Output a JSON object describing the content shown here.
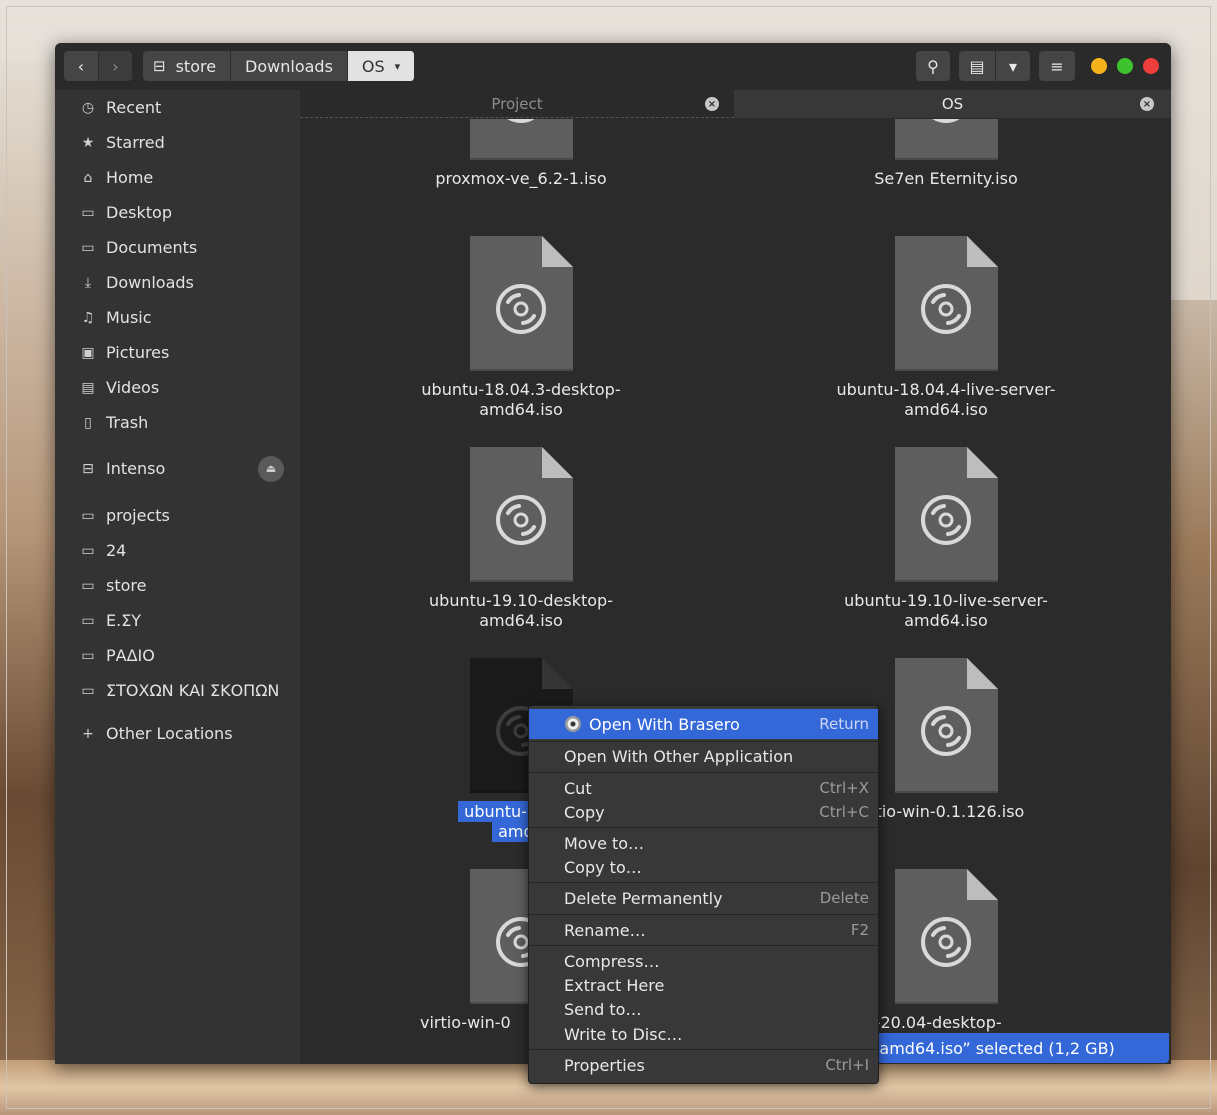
{
  "header": {
    "nav_back_glyph": "‹",
    "nav_fwd_glyph": "›",
    "crumbs": [
      {
        "label": "store",
        "icon": "drive-icon"
      },
      {
        "label": "Downloads"
      },
      {
        "label": "OS"
      }
    ],
    "search_glyph": "⚲",
    "view_glyph": "▤",
    "viewdd_glyph": "▾",
    "menu_glyph": "≡",
    "crumb_drive_glyph": "⊟",
    "crumb_dd_glyph": "▾"
  },
  "sidebar": {
    "items": [
      {
        "label": "Recent",
        "icon": "clock-icon",
        "glyph": "◷"
      },
      {
        "label": "Starred",
        "icon": "star-icon",
        "glyph": "★"
      },
      {
        "label": "Home",
        "icon": "home-icon",
        "glyph": "⌂"
      },
      {
        "label": "Desktop",
        "icon": "folder-icon",
        "glyph": "▭"
      },
      {
        "label": "Documents",
        "icon": "folder-icon",
        "glyph": "▭"
      },
      {
        "label": "Downloads",
        "icon": "download-icon",
        "glyph": "⤓"
      },
      {
        "label": "Music",
        "icon": "music-icon",
        "glyph": "♫"
      },
      {
        "label": "Pictures",
        "icon": "picture-icon",
        "glyph": "▣"
      },
      {
        "label": "Videos",
        "icon": "film-icon",
        "glyph": "▤"
      },
      {
        "label": "Trash",
        "icon": "trash-icon",
        "glyph": "▯"
      },
      {
        "label": "Intenso",
        "icon": "drive-icon",
        "glyph": "⊟"
      },
      {
        "label": "projects",
        "icon": "bookmark-folder-icon",
        "glyph": "▭"
      },
      {
        "label": "24",
        "icon": "bookmark-folder-icon",
        "glyph": "▭"
      },
      {
        "label": "store",
        "icon": "bookmark-folder-icon",
        "glyph": "▭"
      },
      {
        "label": "Ε.ΣΥ",
        "icon": "bookmark-folder-icon",
        "glyph": "▭"
      },
      {
        "label": "ΡΑΔΙΟ",
        "icon": "bookmark-folder-icon",
        "glyph": "▭"
      },
      {
        "label": "ΣΤΟΧΩΝ ΚΑΙ ΣΚΟΠΩΝ",
        "icon": "bookmark-folder-icon",
        "glyph": "▭"
      },
      {
        "label": "Other Locations",
        "icon": "plus-icon",
        "glyph": "+"
      }
    ],
    "eject_glyph": "⏏"
  },
  "tabs": [
    {
      "label": "Project",
      "close_glyph": "×"
    },
    {
      "label": "OS",
      "close_glyph": "×"
    }
  ],
  "files": [
    {
      "name": "proxmox-ve_6.2-1.iso"
    },
    {
      "name": "Se7en Eternity.iso"
    },
    {
      "name": "ubuntu-18.04.3-desktop-amd64.iso",
      "l1": "ubuntu-18.04.3-desktop-",
      "l2": "amd64.iso"
    },
    {
      "name": "ubuntu-18.04.4-live-server-amd64.iso",
      "l1": "ubuntu-18.04.4-live-server-",
      "l2": "amd64.iso"
    },
    {
      "name": "ubuntu-19.10-desktop-amd64.iso",
      "l1": "ubuntu-19.10-desktop-",
      "l2": "amd64.iso"
    },
    {
      "name": "ubuntu-19.10-live-server-amd64.iso",
      "l1": "ubuntu-19.10-live-server-",
      "l2": "amd64.iso"
    },
    {
      "l1": "ubuntu-20.04.",
      "l2": "amd6",
      "selected": true
    },
    {
      "name": "rtio-win-0.1.126.iso"
    },
    {
      "name": "virtio-win-0"
    },
    {
      "l1": "untu-20.04-desktop-",
      "l2": "amd64.iso"
    }
  ],
  "status": {
    "text": "server-amd64.iso” selected  (1,2 GB)"
  },
  "context_menu": {
    "items": [
      {
        "label": "Open With Brasero",
        "accel": "Return",
        "highlighted": true,
        "icon": "brasero-disc-icon"
      },
      {
        "label": "Open With Other Application",
        "accel": ""
      },
      {
        "label": "Cut",
        "accel": "Ctrl+X"
      },
      {
        "label": "Copy",
        "accel": "Ctrl+C"
      },
      {
        "label": "Move to…",
        "accel": ""
      },
      {
        "label": "Copy to…",
        "accel": ""
      },
      {
        "label": "Delete Permanently",
        "accel": "Delete"
      },
      {
        "label": "Rename…",
        "accel": "F2"
      },
      {
        "label": "Compress…",
        "accel": ""
      },
      {
        "label": "Extract Here",
        "accel": ""
      },
      {
        "label": "Send to…",
        "accel": ""
      },
      {
        "label": "Write to Disc…",
        "accel": ""
      },
      {
        "label": "Properties",
        "accel": "Ctrl+I"
      }
    ]
  },
  "colors": {
    "accent": "#3468d8",
    "window_bg": "#2b2b2b",
    "sidebar_bg": "#333333"
  }
}
